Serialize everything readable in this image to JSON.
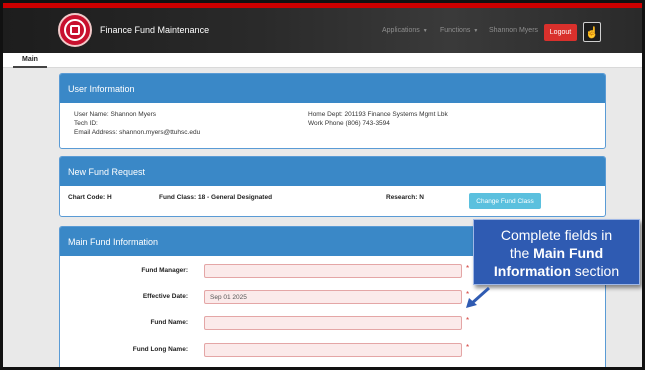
{
  "header": {
    "app_title": "Finance Fund Maintenance",
    "nav": {
      "applications": "Applications",
      "functions": "Functions",
      "user_name": "Shannon Myers",
      "logout": "Logout"
    },
    "colors": {
      "navbar": "#2a2a2a",
      "accent_red": "#cc0000",
      "logout": "#d9302c"
    }
  },
  "tabs": [
    {
      "label": "Main",
      "active": true
    }
  ],
  "user_info": {
    "title": "User Information",
    "user_name": "User Name: Shannon Myers",
    "tech_id": "Tech ID:",
    "email": "Email Address: shannon.myers@ttuhsc.edu",
    "home_dept": "Home Dept: 201193 Finance Systems Mgmt Lbk",
    "work_phone": "Work Phone (806) 743-3594"
  },
  "new_fund_request": {
    "title": "New Fund Request",
    "chart_code": "Chart Code: H",
    "fund_class": "Fund Class: 18 - General Designated",
    "research": "Research: N",
    "change_button": "Change Fund Class"
  },
  "main_fund_info": {
    "title": "Main Fund Information",
    "fields": [
      {
        "label": "Fund Manager:",
        "value": "",
        "required": "*"
      },
      {
        "label": "Effective Date:",
        "value": "Sep 01 2025",
        "required": "*"
      },
      {
        "label": "Fund Name:",
        "value": "",
        "required": "*"
      },
      {
        "label": "Fund Long Name:",
        "value": "",
        "required": "*"
      }
    ]
  },
  "callout": {
    "line1": "Complete fields in",
    "line2_pre": "the",
    "line2_bold": "Main Fund",
    "line3_bold": "Information",
    "line3_post": "section",
    "color": "#2f5bb2"
  }
}
